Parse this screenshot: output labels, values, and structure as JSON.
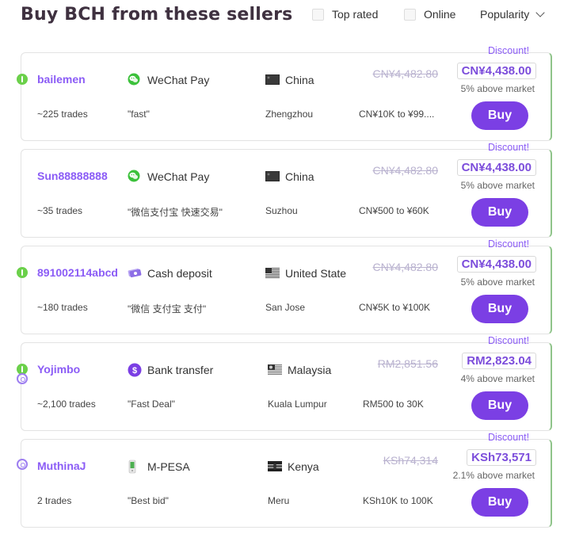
{
  "header": {
    "title": "Buy BCH from these sellers",
    "filters": {
      "top_rated": "Top rated",
      "online": "Online"
    },
    "sort": "Popularity"
  },
  "offers": [
    {
      "discount": "Discount!",
      "seller": "bailemen",
      "trades": "~225 trades",
      "payment_method": "WeChat Pay",
      "payment_icon": "wechat-pay-icon",
      "comment": "\"fast\"",
      "country": "China",
      "city": "Zhengzhou",
      "old_price": "CN¥4,482.80",
      "price": "CN¥4,438.00",
      "limits": "CN¥10K to ¥99....",
      "market": "5% above market",
      "buy": "Buy",
      "online_dot": true,
      "badge": false
    },
    {
      "discount": "Discount!",
      "seller": "Sun88888888",
      "trades": "~35 trades",
      "payment_method": "WeChat Pay",
      "payment_icon": "wechat-pay-icon",
      "comment": "\"微信支付宝 快速交易\"",
      "country": "China",
      "city": "Suzhou",
      "old_price": "CN¥4,482.80",
      "price": "CN¥4,438.00",
      "limits": "CN¥500 to ¥60K",
      "market": "5% above market",
      "buy": "Buy",
      "online_dot": false,
      "badge": false
    },
    {
      "discount": "Discount!",
      "seller": "891002114abcd",
      "trades": "~180 trades",
      "payment_method": "Cash deposit",
      "payment_icon": "cash-deposit-icon",
      "comment": "\"微信 支付宝 支付\"",
      "country": "United State",
      "city": "San Jose",
      "old_price": "CN¥4,482.80",
      "price": "CN¥4,438.00",
      "limits": "CN¥5K to ¥100K",
      "market": "5% above market",
      "buy": "Buy",
      "online_dot": true,
      "badge": false
    },
    {
      "discount": "Discount!",
      "seller": "Yojimbo",
      "trades": "~2,100 trades",
      "payment_method": "Bank transfer",
      "payment_icon": "bank-transfer-icon",
      "comment": "\"Fast Deal\"",
      "country": "Malaysia",
      "city": "Kuala Lumpur",
      "old_price": "RM2,851.56",
      "price": "RM2,823.04",
      "limits": "RM500 to 30K",
      "market": "4% above market",
      "buy": "Buy",
      "online_dot": true,
      "badge": true
    },
    {
      "discount": "Discount!",
      "seller": "MuthinaJ",
      "trades": "2 trades",
      "payment_method": "M-PESA",
      "payment_icon": "m-pesa-icon",
      "comment": "\"Best bid\"",
      "country": "Kenya",
      "city": "Meru",
      "old_price": "KSh74,314",
      "price": "KSh73,571",
      "limits": "KSh10K to 100K",
      "market": "2.1% above market",
      "buy": "Buy",
      "online_dot": false,
      "badge": true
    }
  ],
  "colors": {
    "accent": "#7b3fe4",
    "seller": "#8b5cf6",
    "online": "#6bd04a",
    "title": "#3f3140"
  }
}
